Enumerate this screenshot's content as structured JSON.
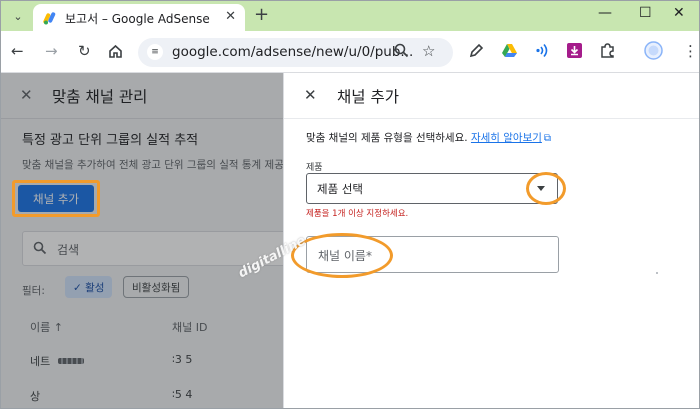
{
  "browser": {
    "tab_title": "보고서 – Google AdSense",
    "url": "google.com/adsense/new/u/0/pub...",
    "colors": {
      "tabstrip": "#c8e6b0",
      "omnibox": "#eef1f6"
    },
    "window_buttons": [
      "minimize-icon",
      "maximize-icon",
      "close-icon"
    ],
    "toolbar_icons": [
      "back-arrow-icon",
      "forward-arrow-icon",
      "reload-icon",
      "home-icon"
    ],
    "extension_icons": [
      "pencil-icon",
      "google-drive-icon",
      "wifi-signal-icon",
      "download-box-icon",
      "puzzle-icon",
      "profile-avatar-icon",
      "more-icon"
    ]
  },
  "left_page": {
    "title": "맞춤 채널 관리",
    "subtitle": "특정 광고 단위 그룹의 실적 추적",
    "description": "맞춤 채널을 추가하여 전체 광고 단위 그룹의 실적 통계 제공 방",
    "add_button": "채널 추가",
    "search_placeholder": "검색",
    "filter_label": "필터:",
    "chip_active": "✓ 활성",
    "chip_inactive": "비활성화됨",
    "columns": [
      "이름 ↑",
      "채널 ID"
    ],
    "rows": [
      {
        "name": "네트",
        "id": "∶3 5"
      },
      {
        "name": "상",
        "id": "∶5 4"
      }
    ]
  },
  "panel": {
    "title": "채널 추가",
    "description": "맞춤 채널의 제품 유형을 선택하세요.",
    "learn_more": "자세히 알아보기",
    "product_label": "제품",
    "product_select_value": "제품 선택",
    "product_error": "제품을 1개 이상 지정하세요.",
    "name_placeholder": "채널 이름*"
  },
  "watermark": "digitalline",
  "colors": {
    "accent": "#1a73e8",
    "highlight_ring": "#f29b2b",
    "error": "#c5221f"
  }
}
